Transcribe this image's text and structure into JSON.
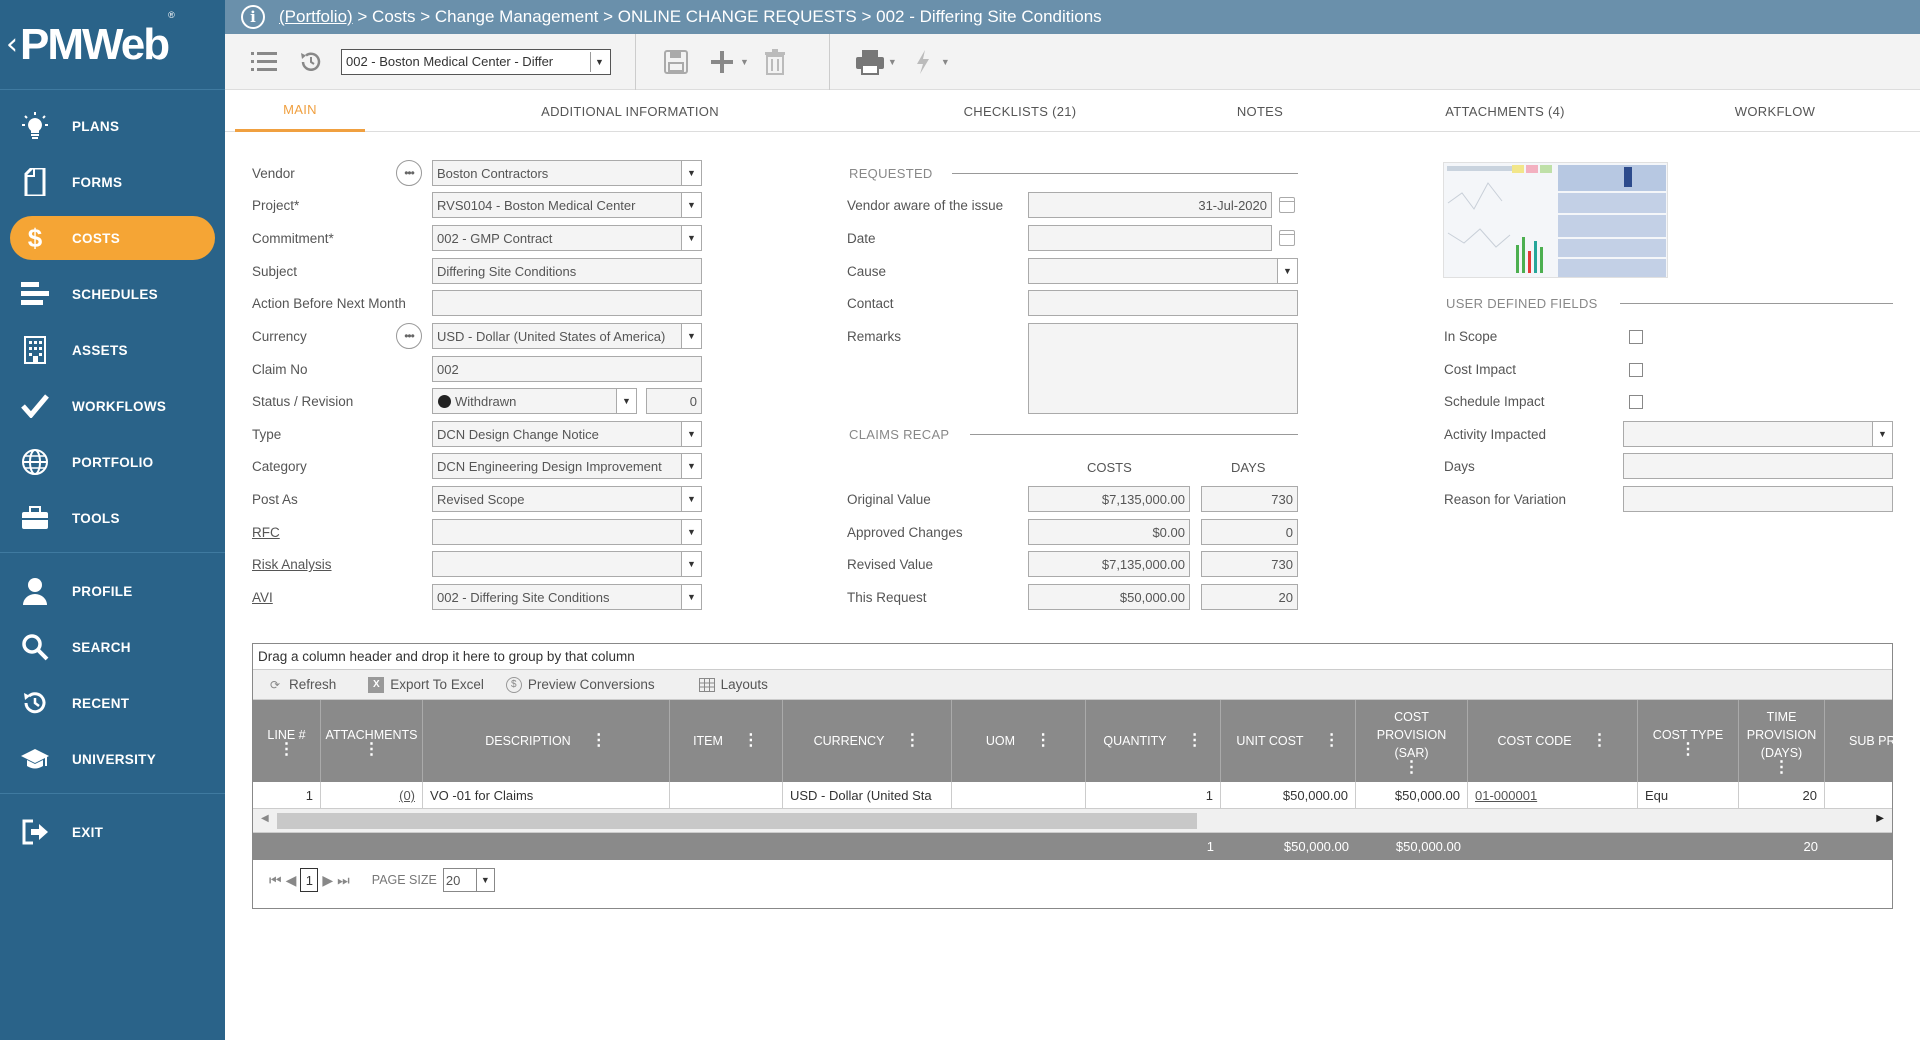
{
  "app": {
    "logo_text": "PMWeb",
    "logo_mark": "®"
  },
  "sidebar": {
    "items": [
      {
        "label": "PLANS",
        "icon": "lightbulb-icon"
      },
      {
        "label": "FORMS",
        "icon": "document-icon"
      },
      {
        "label": "COSTS",
        "icon": "dollar-icon",
        "active": true
      },
      {
        "label": "SCHEDULES",
        "icon": "schedule-bars-icon"
      },
      {
        "label": "ASSETS",
        "icon": "building-icon"
      },
      {
        "label": "WORKFLOWS",
        "icon": "checkmark-icon"
      },
      {
        "label": "PORTFOLIO",
        "icon": "globe-icon"
      },
      {
        "label": "TOOLS",
        "icon": "toolbox-icon"
      },
      {
        "label": "PROFILE",
        "icon": "person-icon"
      },
      {
        "label": "SEARCH",
        "icon": "search-icon"
      },
      {
        "label": "RECENT",
        "icon": "history-icon"
      },
      {
        "label": "UNIVERSITY",
        "icon": "graduation-cap-icon"
      },
      {
        "label": "EXIT",
        "icon": "exit-icon"
      }
    ]
  },
  "breadcrumb": {
    "root": "(Portfolio)",
    "rest": " > Costs > Change Management > ONLINE CHANGE REQUESTS > 002 - Differing Site Conditions"
  },
  "toolbar": {
    "record_select": "002 - Boston Medical Center - Differ"
  },
  "tabs": [
    "MAIN",
    "ADDITIONAL INFORMATION",
    "CHECKLISTS (21)",
    "NOTES",
    "ATTACHMENTS (4)",
    "WORKFLOW"
  ],
  "form": {
    "vendor": {
      "label": "Vendor",
      "value": "Boston Contractors"
    },
    "project": {
      "label": "Project*",
      "value": "RVS0104 - Boston Medical Center"
    },
    "commitment": {
      "label": "Commitment*",
      "value": "002 - GMP Contract"
    },
    "subject": {
      "label": "Subject",
      "value": "Differing Site Conditions"
    },
    "action_before": {
      "label": "Action Before Next Month",
      "value": ""
    },
    "currency": {
      "label": "Currency",
      "value": "USD - Dollar (United States of America)"
    },
    "claim_no": {
      "label": "Claim No",
      "value": "002"
    },
    "status": {
      "label": "Status / Revision",
      "value": "Withdrawn",
      "revision": "0"
    },
    "type": {
      "label": "Type",
      "value": "DCN Design Change Notice"
    },
    "category": {
      "label": "Category",
      "value": "DCN Engineering Design Improvement"
    },
    "post_as": {
      "label": "Post As",
      "value": "Revised Scope"
    },
    "rfc": {
      "label": "RFC",
      "value": ""
    },
    "risk": {
      "label": "Risk Analysis",
      "value": ""
    },
    "avi": {
      "label": "AVI",
      "value": "002 - Differing Site Conditions"
    }
  },
  "requested": {
    "title": "REQUESTED",
    "vendor_aware": {
      "label": "Vendor aware of the issue",
      "value": "31-Jul-2020"
    },
    "date": {
      "label": "Date",
      "value": ""
    },
    "cause": {
      "label": "Cause",
      "value": ""
    },
    "contact": {
      "label": "Contact",
      "value": ""
    },
    "remarks": {
      "label": "Remarks",
      "value": ""
    }
  },
  "claims_recap": {
    "title": "CLAIMS RECAP",
    "col_costs": "COSTS",
    "col_days": "DAYS",
    "rows": [
      {
        "label": "Original Value",
        "costs": "$7,135,000.00",
        "days": "730"
      },
      {
        "label": "Approved Changes",
        "costs": "$0.00",
        "days": "0"
      },
      {
        "label": "Revised Value",
        "costs": "$7,135,000.00",
        "days": "730"
      },
      {
        "label": "This Request",
        "costs": "$50,000.00",
        "days": "20"
      }
    ]
  },
  "udf": {
    "title": "USER DEFINED FIELDS",
    "in_scope": "In Scope",
    "cost_impact": "Cost Impact",
    "schedule_impact": "Schedule Impact",
    "activity_impacted": "Activity Impacted",
    "days": "Days",
    "reason": "Reason for Variation"
  },
  "grid": {
    "group_hint": "Drag a column header and drop it here to group by that column",
    "tools": {
      "refresh": "Refresh",
      "export": "Export To Excel",
      "preview": "Preview Conversions",
      "layouts": "Layouts"
    },
    "headers": [
      "LINE #",
      "ATTACHMENTS",
      "DESCRIPTION",
      "ITEM",
      "CURRENCY",
      "UOM",
      "QUANTITY",
      "UNIT COST",
      "COST PROVISION (SAR)",
      "COST CODE",
      "COST TYPE",
      "TIME PROVISION (DAYS)",
      "SUB PR"
    ],
    "row": {
      "line": "1",
      "attachments": "(0)",
      "description": "VO -01 for Claims",
      "item": "",
      "currency": "USD - Dollar (United Sta",
      "uom": "",
      "quantity": "1",
      "unit_cost": "$50,000.00",
      "cost_provision": "$50,000.00",
      "cost_code": "01-000001",
      "cost_type": "Equ",
      "time_provision": "20"
    },
    "footer": {
      "quantity": "1",
      "unit_cost": "$50,000.00",
      "cost_provision": "$50,000.00",
      "time_provision": "20"
    },
    "pager": {
      "page": "1",
      "page_size_label": "PAGE SIZE",
      "page_size": "20"
    }
  }
}
